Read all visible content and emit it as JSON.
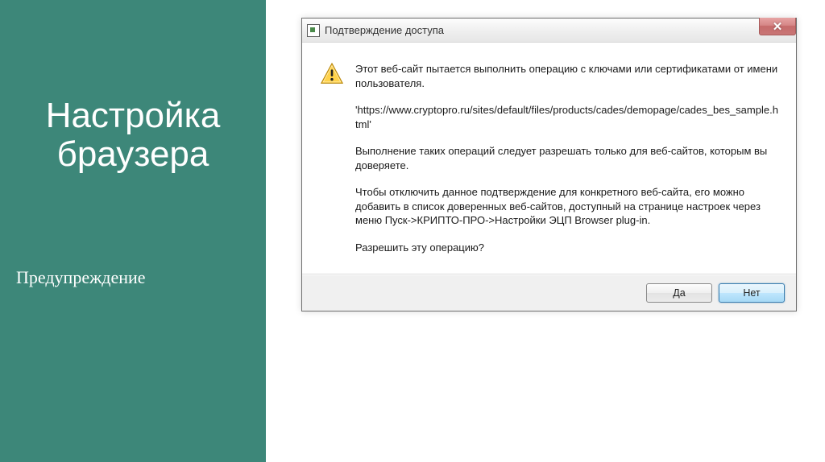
{
  "slide": {
    "title": "Настройка браузера",
    "subtitle": "Предупреждение"
  },
  "dialog": {
    "title": "Подтверждение доступа",
    "close_glyph": "✕",
    "msg1": "Этот веб-сайт пытается выполнить операцию с ключами или сертификатами от имени пользователя.",
    "url": "'https://www.cryptopro.ru/sites/default/files/products/cades/demopage/cades_bes_sample.html'",
    "msg2": "Выполнение таких операций следует разрешать только для веб-сайтов, которым вы доверяете.",
    "msg3": "Чтобы отключить данное подтверждение для конкретного веб-сайта, его можно добавить в список доверенных веб-сайтов, доступный на странице настроек через меню Пуск->КРИПТО-ПРО->Настройки ЭЦП Browser plug-in.",
    "msg4": "Разрешить эту операцию?",
    "yes_label": "Да",
    "no_label": "Нет"
  }
}
